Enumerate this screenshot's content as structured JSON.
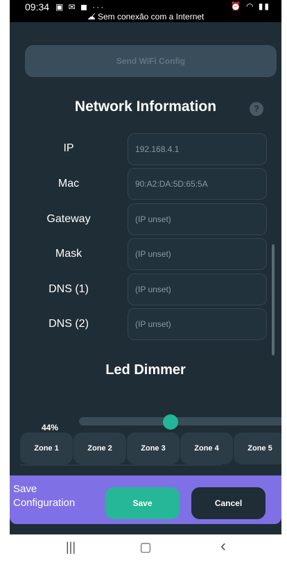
{
  "status_bar": {
    "time": "09:34",
    "notif_icons": "▣ ✉ ◼ ···",
    "sys_icons": "⏰ ◠ ▮▮",
    "offline_text": "Sem conexão com a Internet"
  },
  "send_wifi": {
    "label": "Send WiFi Config"
  },
  "network": {
    "title": "Network Information",
    "help_icon": "?",
    "rows": [
      {
        "label": "IP",
        "value": "192.168.4.1"
      },
      {
        "label": "Mac",
        "value": "90:A2:DA:5D:65:5A"
      },
      {
        "label": "Gateway",
        "value": "(IP unset)"
      },
      {
        "label": "Mask",
        "value": "(IP unset)"
      },
      {
        "label": "DNS (1)",
        "value": "(IP unset)"
      },
      {
        "label": "DNS (2)",
        "value": "(IP unset)"
      }
    ]
  },
  "led": {
    "title": "Led Dimmer",
    "percent_label": "44%",
    "level": 0.44,
    "zones": [
      "Zone 1",
      "Zone 2",
      "Zone 3",
      "Zone 4",
      "Zone 5"
    ]
  },
  "save_bar": {
    "label": "Save Configuration",
    "save": "Save",
    "cancel": "Cancel"
  },
  "nav": {
    "recent": "|||",
    "home": "▢",
    "back": "‹"
  }
}
